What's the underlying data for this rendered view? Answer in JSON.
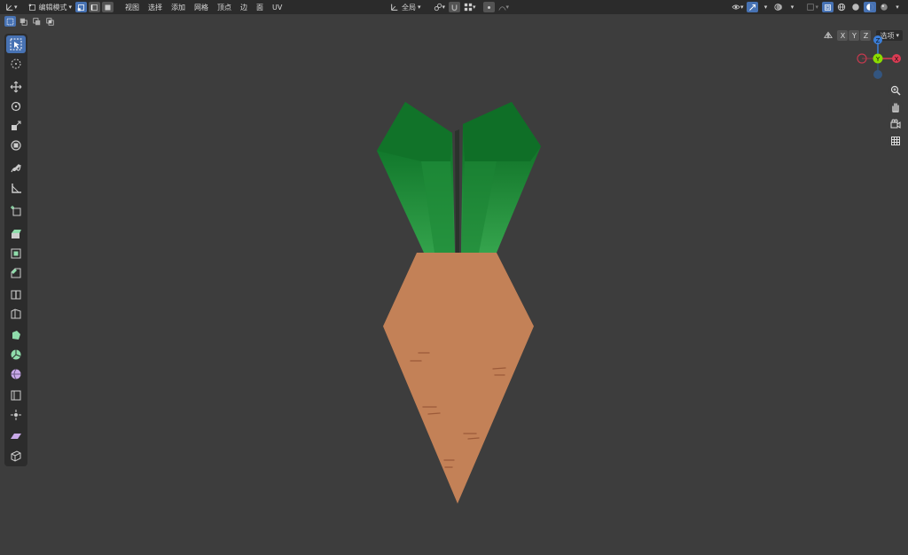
{
  "header": {
    "mode_label": "编辑模式",
    "menus": [
      "视图",
      "选择",
      "添加",
      "网格",
      "顶点",
      "边",
      "面",
      "UV"
    ],
    "transform_orientation": "全局"
  },
  "viewport_header": {
    "axes": [
      "X",
      "Y",
      "Z"
    ],
    "options_label": "选项"
  },
  "gizmo": {
    "z_label": "Z",
    "y_label": "Y",
    "x_label": "X"
  },
  "colors": {
    "accent": "#4772b3",
    "carrot": "#c38157",
    "leaf_dark": "#13752b",
    "leaf_light": "#2ea048",
    "background": "#3d3d3d"
  },
  "icons": {
    "tools": [
      "select-box-icon",
      "cursor-icon",
      "move-icon",
      "rotate-icon",
      "scale-icon",
      "transform-icon",
      "annotate-icon",
      "measure-icon",
      "add-cube-icon",
      "extrude-icon",
      "inset-icon",
      "bevel-icon",
      "loop-cut-icon",
      "knife-icon",
      "poly-build-icon",
      "spin-icon",
      "smooth-icon",
      "edge-slide-icon",
      "shrink-fatten-icon",
      "shear-icon",
      "rip-region-icon"
    ]
  }
}
